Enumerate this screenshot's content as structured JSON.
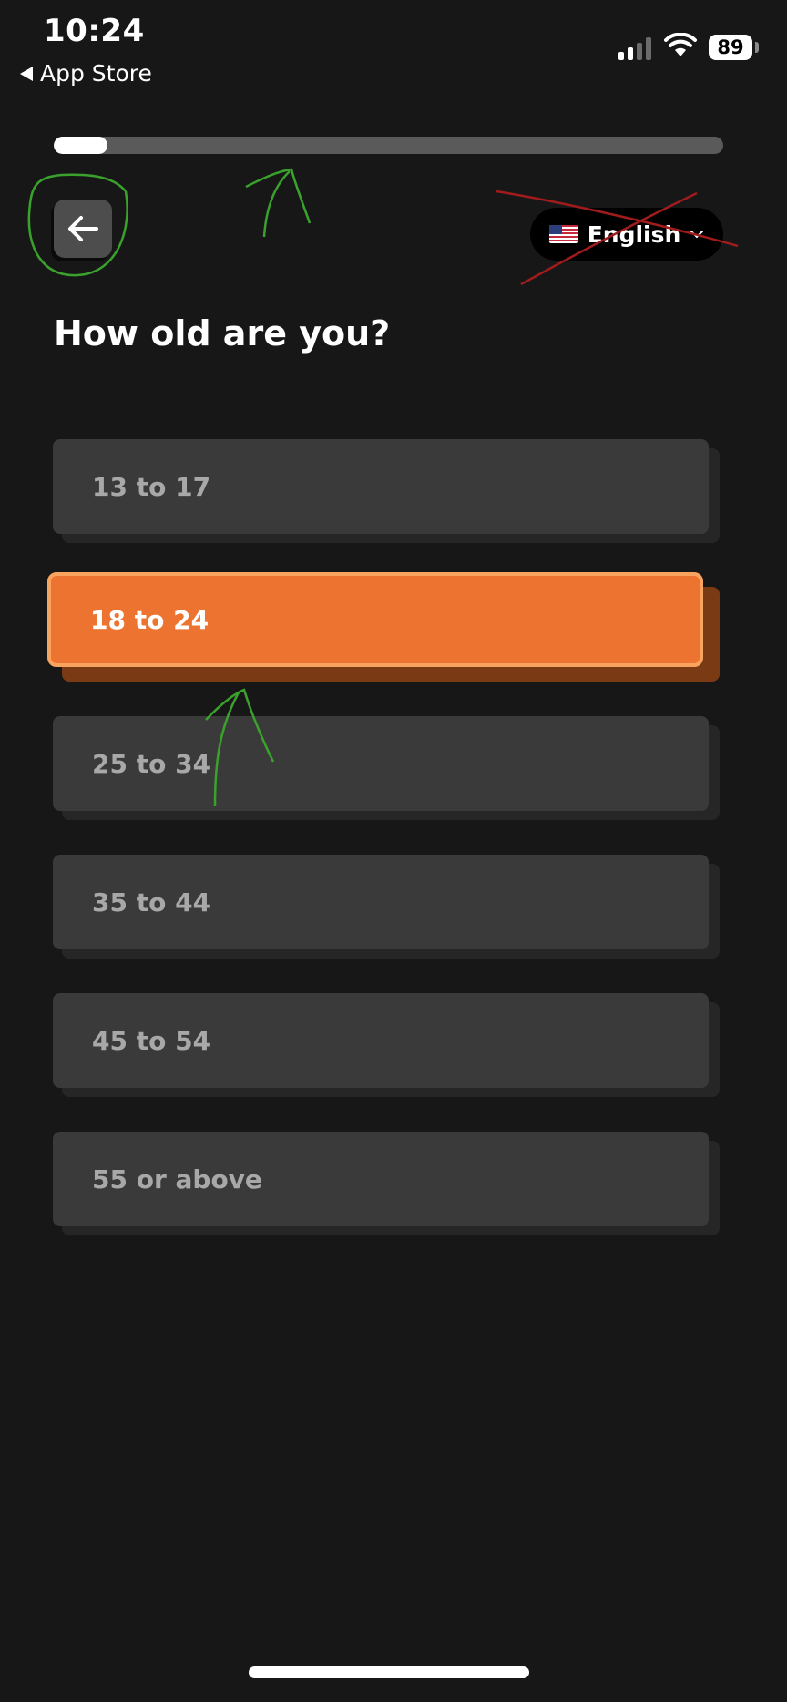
{
  "status_bar": {
    "time": "10:24",
    "back_app_label": "App Store",
    "battery": "89"
  },
  "progress": {
    "value": 0.08
  },
  "header": {
    "back_icon": "arrow-left-icon",
    "language": {
      "flag": "us-flag-icon",
      "label": "English",
      "chevron": "chevron-down-icon"
    }
  },
  "question": {
    "title": "How old are you?"
  },
  "options": [
    {
      "label": "13 to 17",
      "selected": false
    },
    {
      "label": "18 to 24",
      "selected": true
    },
    {
      "label": "25 to 34",
      "selected": false
    },
    {
      "label": "35 to 44",
      "selected": false
    },
    {
      "label": "45 to 54",
      "selected": false
    },
    {
      "label": "55 or above",
      "selected": false
    }
  ],
  "colors": {
    "background": "#171717",
    "accent": "#ec7430",
    "accent_border": "#f8a45e",
    "option_bg": "#3a3a3a",
    "annotation_green": "#3aa22c",
    "annotation_red": "#a01c1c"
  }
}
